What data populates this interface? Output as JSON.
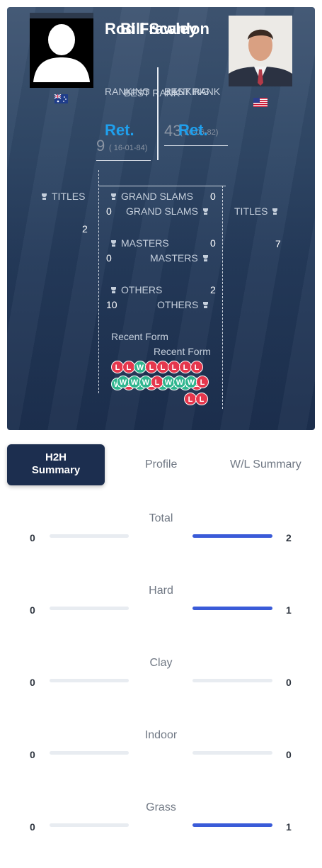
{
  "player1": {
    "name": "Rod Frawley",
    "flag": "AU",
    "rank_label": "RANKING",
    "rank_value": "Ret.",
    "best_rank_label": "BEST RANK",
    "best_rank_value": "9",
    "best_rank_date": "( 16-01-84)",
    "titles_label": "TITLES",
    "titles_value": "2",
    "grand_slams_label": "GRAND SLAMS",
    "grand_slams_value": "0",
    "masters_label": "MASTERS",
    "masters_value": "0",
    "others_label": "OTHERS",
    "others_value": "2",
    "recent_form_label": "Recent Form",
    "recent_form": [
      "L",
      "L",
      "W",
      "L",
      "L",
      "L",
      "L",
      "L",
      "W",
      "L",
      "W",
      "L",
      "W",
      "W",
      "W",
      "L"
    ]
  },
  "player2": {
    "name": "Bill Scanlon",
    "flag": "US",
    "rank_label": "RANKING",
    "rank_value": "Ret.",
    "best_rank_label": "BEST RANK",
    "best_rank_value": "43",
    "best_rank_date": "( 26-06-82)",
    "titles_label": "TITLES",
    "titles_value": "7",
    "grand_slams_label": "GRAND SLAMS",
    "grand_slams_value": "0",
    "masters_label": "MASTERS",
    "masters_value": "0",
    "others_label": "OTHERS",
    "others_value": "10",
    "recent_form_label": "Recent Form",
    "recent_form": [
      "W",
      "W",
      "W",
      "L",
      "W",
      "W",
      "W",
      "L",
      "L",
      "L"
    ]
  },
  "tabs": {
    "h2h": "H2H Summary",
    "profile": "Profile",
    "wl": "W/L Summary"
  },
  "summary": [
    {
      "label": "Total",
      "left": "0",
      "right": "2",
      "left_frac": 0,
      "right_frac": 1
    },
    {
      "label": "Hard",
      "left": "0",
      "right": "1",
      "left_frac": 0,
      "right_frac": 1
    },
    {
      "label": "Clay",
      "left": "0",
      "right": "0",
      "left_frac": 0,
      "right_frac": 0
    },
    {
      "label": "Indoor",
      "left": "0",
      "right": "0",
      "left_frac": 0,
      "right_frac": 0
    },
    {
      "label": "Grass",
      "left": "0",
      "right": "1",
      "left_frac": 0,
      "right_frac": 1
    }
  ],
  "colors": {
    "loss": "#e5374d",
    "win": "#2fb58e",
    "accent": "#1fa0ee",
    "bar": "#3a5bd8",
    "tab_active": "#1c2e4f"
  }
}
